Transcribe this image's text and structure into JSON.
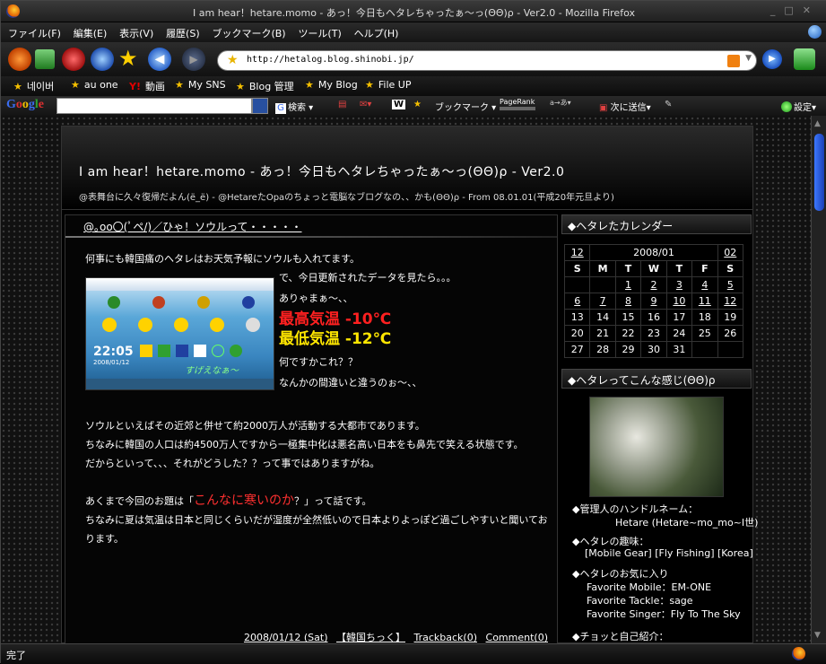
{
  "window": {
    "title": "I am hear！hetare.momo - あっ！今日もヘタレちゃったぁ～っ(ΘΘ)ρ - Ver2.0 - Mozilla Firefox"
  },
  "menu": [
    {
      "label": "ファイル(F)"
    },
    {
      "label": "編集(E)"
    },
    {
      "label": "表示(V)"
    },
    {
      "label": "履歴(S)"
    },
    {
      "label": "ブックマーク(B)"
    },
    {
      "label": "ツール(T)"
    },
    {
      "label": "ヘルプ(H)"
    }
  ],
  "nav": {
    "url": "http://hetalog.blog.shinobi.jp/"
  },
  "bookmarks": [
    "네이버",
    "au one",
    "動画",
    "My SNS",
    "Blog 管理",
    "My Blog",
    "File UP"
  ],
  "gtoolbar": {
    "logo": "Google",
    "search_btn": "検索",
    "bookmark": "ブックマーク",
    "pagerank": "PageRank",
    "share": "次に送信",
    "settings": "設定"
  },
  "status": {
    "text": "完了"
  },
  "blog": {
    "title": "I am hear！hetare.momo - あっ！今日もヘタレちゃったぁ～っ(ΘΘ)ρ - Ver2.0",
    "subtitle": "@表舞台に久々復帰だよん(ё_ё) - @HetareたOpaのちょっと電脳なブログなの、、かも(ΘΘ)ρ - From 08.01.01(平成20年元旦より)"
  },
  "entry": {
    "title": "@｡oo〇(ﾟペ/)／ひゃ！ソウルって・・・・・",
    "p1": "何事にも韓国痛のヘタレはお天気予報にソウルも入れてます。",
    "side1": "で、今日更新されたデータを見たら。。。",
    "side2": "ありゃまぁ～、、",
    "hot1": "最高気温 -10℃",
    "hot2": "最低気温 -12℃",
    "side3": "何ですかこれ？？",
    "side4": "なんかの間違いと違うのぉ～、、",
    "p2": "ソウルといえばその近郊と併せて約2000万人が活動する大都市であります。",
    "p3": "ちなみに韓国の人口は約4500万人ですから一極集中化は悪名高い日本をも鼻先で笑える状態です。",
    "p4": "だからといって、、、それがどうした？？って事ではありますがね。",
    "p5a": "あくまで今回のお題は「",
    "p5b": "こんなに寒いのか",
    "p5c": "？」って話です。",
    "p6": "ちなみに夏は気温は日本と同じくらいだが湿度が全然低いので日本よりよっぽど過ごしやすいと聞いております。",
    "footer": {
      "date": "2008/01/12 (Sat)",
      "cat": "【韓国ちっく】",
      "tb": "Trackback(0)",
      "cm": "Comment(0)"
    },
    "image": {
      "time": "22:05",
      "date": "2008/01/12",
      "caption": "すげえなぁ～"
    }
  },
  "sidebar": {
    "cal_title": "◆ヘタレたカレンダー",
    "prev": "12",
    "month": "2008/01",
    "next": "02",
    "days": [
      "S",
      "M",
      "T",
      "W",
      "T",
      "F",
      "S"
    ],
    "weeks": [
      [
        "",
        "",
        "1",
        "2",
        "3",
        "4",
        "5"
      ],
      [
        "6",
        "7",
        "8",
        "9",
        "10",
        "11",
        "12"
      ],
      [
        "13",
        "14",
        "15",
        "16",
        "17",
        "18",
        "19"
      ],
      [
        "20",
        "21",
        "22",
        "23",
        "24",
        "25",
        "26"
      ],
      [
        "27",
        "28",
        "29",
        "30",
        "31",
        "",
        ""
      ]
    ],
    "about_title": "◆ヘタレってこんな感じ(ΘΘ)ρ",
    "handle_label": "◆管理人のハンドルネーム：",
    "handle": "Hetare (Hetare~mo_mo~Ⅰ世)",
    "hobby_label": "◆ヘタレの趣味：",
    "hobby": "[Mobile Gear] [Fly Fishing] [Korea]",
    "fav_label": "◆ヘタレのお気に入り",
    "fav1": "Favorite Mobile：EM-ONE",
    "fav2": "Favorite Tackle：sage",
    "fav3": "Favorite Singer：Fly To The Sky",
    "intro_label": "◆チョッと自己紹介："
  },
  "colors": {
    "hot1": "#ff2020",
    "hot2": "#ffe600",
    "red_text": "#ff3030",
    "accent_scroll": "#2f5fe0"
  }
}
